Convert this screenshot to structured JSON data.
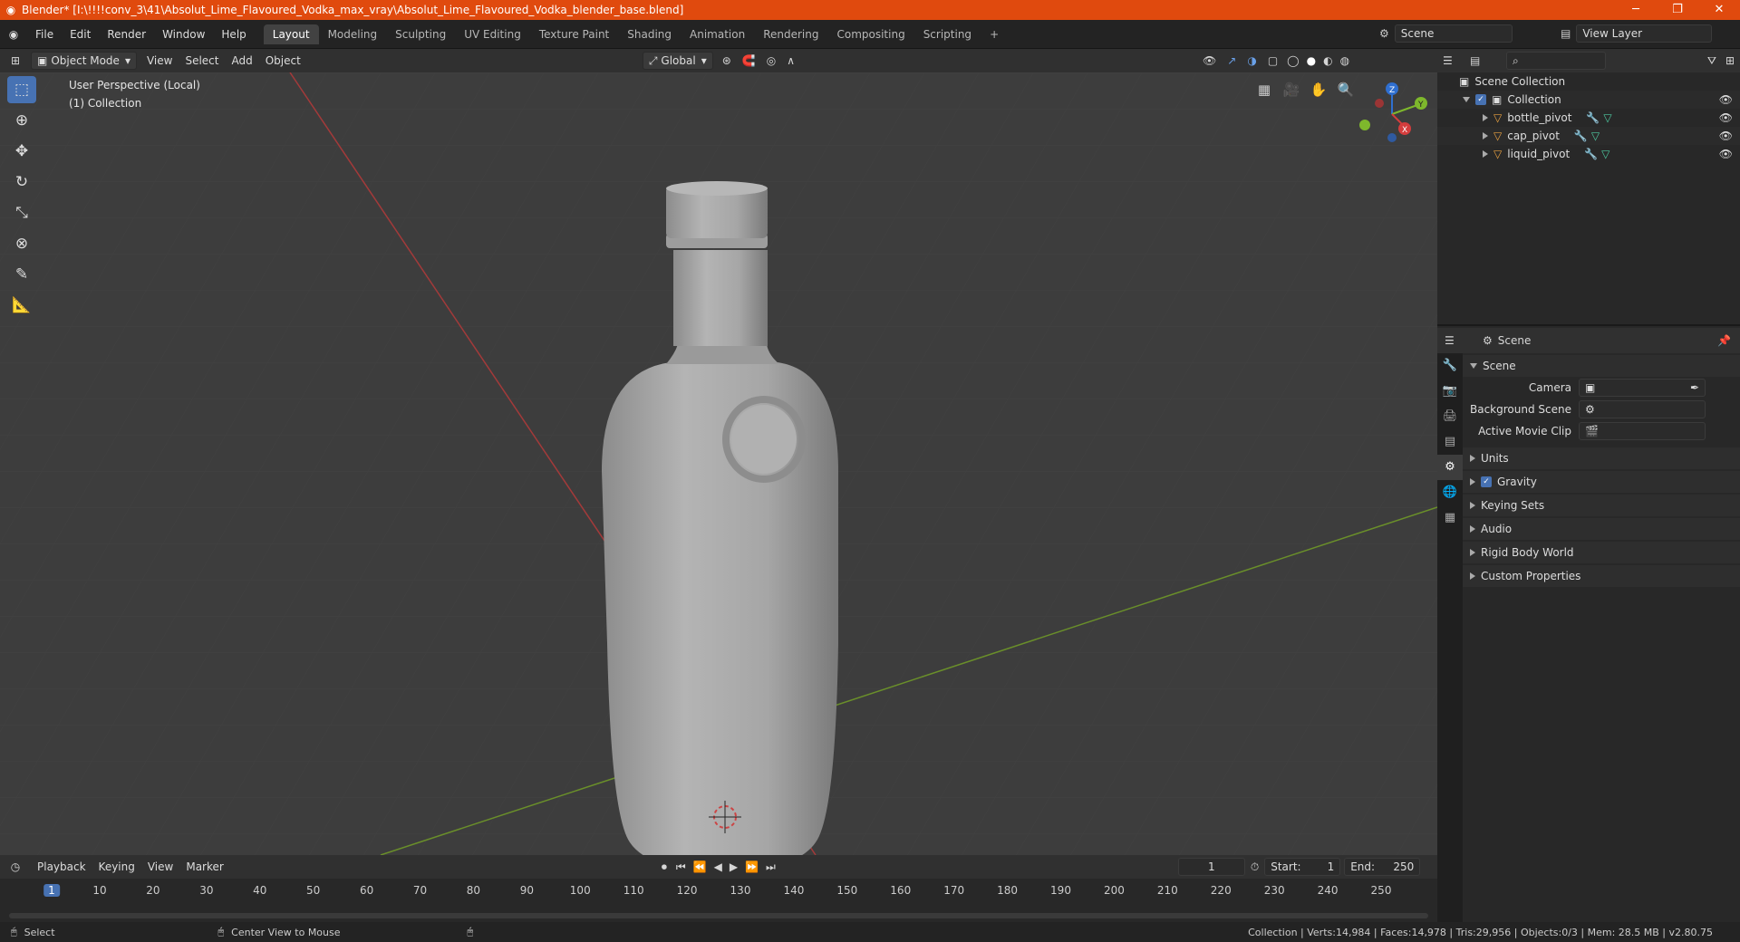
{
  "window": {
    "title": "Blender* [I:\\!!!!conv_3\\41\\Absolut_Lime_Flavoured_Vodka_max_vray\\Absolut_Lime_Flavoured_Vodka_blender_base.blend]",
    "minimize": "─",
    "maximize": "❐",
    "close": "✕"
  },
  "menu": [
    "File",
    "Edit",
    "Render",
    "Window",
    "Help"
  ],
  "workspaces": [
    {
      "label": "Layout",
      "active": true
    },
    {
      "label": "Modeling"
    },
    {
      "label": "Sculpting"
    },
    {
      "label": "UV Editing"
    },
    {
      "label": "Texture Paint"
    },
    {
      "label": "Shading"
    },
    {
      "label": "Animation"
    },
    {
      "label": "Rendering"
    },
    {
      "label": "Compositing"
    },
    {
      "label": "Scripting"
    }
  ],
  "add_workspace": "+",
  "scene_selector": {
    "value": "Scene"
  },
  "view_layer_selector": {
    "value": "View Layer"
  },
  "viewport_header": {
    "mode": "Object Mode",
    "menus": [
      "View",
      "Select",
      "Add",
      "Object"
    ],
    "orientation": "Global"
  },
  "viewport": {
    "info_line1": "User Perspective (Local)",
    "info_line2": "(1) Collection",
    "gizmo": {
      "x": "X",
      "y": "Y",
      "z": "Z"
    }
  },
  "colors": {
    "accent": "#4772b3",
    "titlebar": "#e04a0e",
    "x_axis": "#a33a3a",
    "y_axis": "#6a8f2a",
    "bottle": "#a9a9a9"
  },
  "outliner": {
    "root": "Scene Collection",
    "collection": "Collection",
    "items": [
      {
        "label": "bottle_pivot"
      },
      {
        "label": "cap_pivot"
      },
      {
        "label": "liquid_pivot"
      }
    ]
  },
  "properties": {
    "header": "Scene",
    "panel_title": "Scene",
    "camera_label": "Camera",
    "background_scene_label": "Background Scene",
    "active_movie_clip_label": "Active Movie Clip",
    "sections": [
      "Units",
      "Gravity",
      "Keying Sets",
      "Audio",
      "Rigid Body World",
      "Custom Properties"
    ]
  },
  "timeline": {
    "menus": [
      "Playback",
      "Keying",
      "View",
      "Marker"
    ],
    "current_frame": "1",
    "start_label": "Start:",
    "start": "1",
    "end_label": "End:",
    "end": "250",
    "ticks": [
      "1",
      "10",
      "20",
      "30",
      "40",
      "50",
      "60",
      "70",
      "80",
      "90",
      "100",
      "110",
      "120",
      "130",
      "140",
      "150",
      "160",
      "170",
      "180",
      "190",
      "200",
      "210",
      "220",
      "230",
      "240",
      "250"
    ]
  },
  "statusbar": {
    "select": "Select",
    "center_view": "Center View to Mouse",
    "stats": "Collection | Verts:14,984 | Faces:14,978 | Tris:29,956 | Objects:0/3 | Mem: 28.5 MB | v2.80.75"
  }
}
